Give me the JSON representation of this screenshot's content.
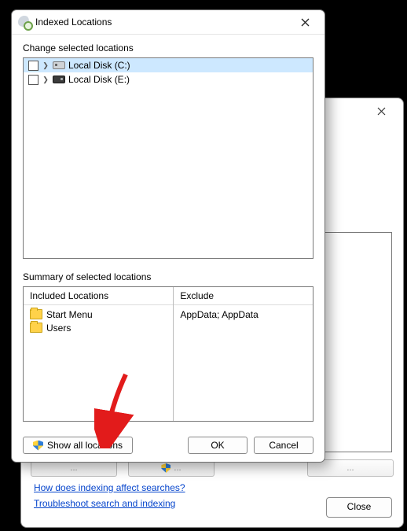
{
  "front": {
    "title": "Indexed Locations",
    "change_label": "Change selected locations",
    "tree": [
      {
        "label": "Local Disk (C:)",
        "selected": true,
        "icon": "light"
      },
      {
        "label": "Local Disk (E:)",
        "selected": false,
        "icon": "dark"
      }
    ],
    "summary_label": "Summary of selected locations",
    "columns": {
      "included_head": "Included Locations",
      "exclude_head": "Exclude",
      "included": [
        "Start Menu",
        "Users"
      ],
      "exclude": [
        "",
        "AppData; AppData"
      ]
    },
    "buttons": {
      "show_all": "Show all locations",
      "ok": "OK",
      "cancel": "Cancel"
    }
  },
  "back": {
    "links": {
      "affect": "How does indexing affect searches?",
      "troubleshoot": "Troubleshoot search and indexing"
    },
    "close": "Close"
  }
}
